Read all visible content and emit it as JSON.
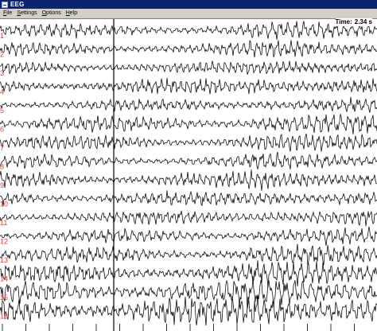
{
  "window": {
    "title": "EEG",
    "title_color": "#0a2472"
  },
  "menu": {
    "items": [
      {
        "label": "File",
        "underline": "F",
        "rest": "ile"
      },
      {
        "label": "Settings",
        "underline": "S",
        "rest": "ettings"
      },
      {
        "label": "Options",
        "underline": "O",
        "rest": "ptions"
      },
      {
        "label": "Help",
        "underline": "H",
        "rest": "elp"
      }
    ]
  },
  "time": {
    "label": "Time:",
    "value": "2.34 s"
  },
  "plot": {
    "trace_color": "#000000",
    "label_color": "#e04040",
    "channels": [
      "1",
      "2",
      "3",
      "4",
      "5",
      "6",
      "7",
      "8",
      "9",
      "10",
      "11",
      "12",
      "13",
      "14",
      "15",
      "16"
    ]
  }
}
